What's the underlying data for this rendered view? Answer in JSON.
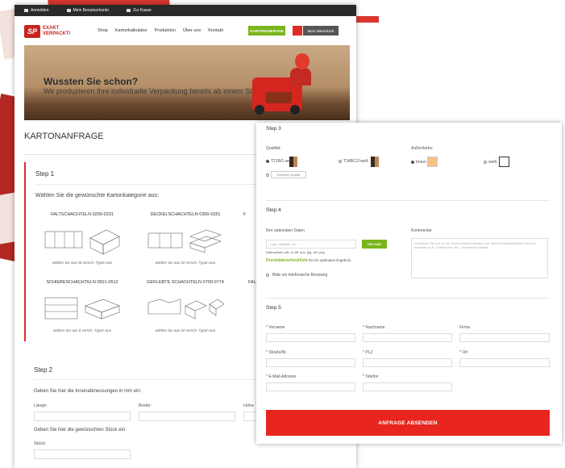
{
  "topbar": {
    "items": [
      {
        "label": "Anmelden",
        "icon": "login-icon"
      },
      {
        "label": "Mein Benutzerkonto",
        "icon": "user-icon"
      },
      {
        "label": "Zur Kasse",
        "icon": "cart-icon"
      }
    ]
  },
  "header": {
    "logo_line1": "EXAKT",
    "logo_line2": "VERPACKT!",
    "logo_mark": "SP",
    "nav": [
      "Shop",
      "Kartonkalkulator",
      "Produktion",
      "Über uns",
      "Kontakt"
    ],
    "cta_label": "KARTONANFRAGE",
    "cart_label": "Mein Warenkorb",
    "colors": {
      "accent": "#e22a26",
      "green": "#7ab51d",
      "dark": "#2a2a2a"
    }
  },
  "banner": {
    "title": "Wussten Sie schon?",
    "subtitle": "Wir produzieren Ihre individuelle Verpackung bereits ab einem Stück"
  },
  "page_title": "KARTONANFRAGE",
  "step1": {
    "label": "Step 1",
    "instruction": "Wählen Sie die gewünschte Kartonkategorie aus:",
    "categories": [
      {
        "name": "FALTSCHACHTELN 0200-0231",
        "note": "wählen Sie aus 25 versch. Typen aus"
      },
      {
        "name": "DECKELSCHACHTELN 0300-0351",
        "note": "wählen Sie aus 32 versch. Typen aus"
      },
      {
        "name": "F",
        "note": ""
      },
      {
        "name": "SCHIEBESCHACHTELN 0501-0512",
        "note": "wählen Sie aus 8 versch. Typen aus"
      },
      {
        "name": "GEKLEBTE SCHACHTELN 0700-0774",
        "note": "wählen Sie aus 32 versch. Typen aus"
      },
      {
        "name": "FAL",
        "note": ""
      }
    ]
  },
  "step2": {
    "label": "Step 2",
    "instruction_dims": "Geben Sie hier die Innenabmessungen in mm ein:",
    "length_label": "Länge:",
    "width_label": "Breite:",
    "height_label": "Höhe",
    "instruction_qty": "Geben Sie hier die gewünschten Stück ein:",
    "qty_label": "Stück:"
  },
  "step3": {
    "label": "Step 3",
    "quality_label": "Qualität:",
    "quality_options": [
      "T21B/1-welt.",
      "T34BC/2-welt."
    ],
    "quality_selected": "T21B/1-welt.",
    "quality_more": "Erweiterte Qualität",
    "color_label": "Außenfarbe:",
    "color_options": [
      "braun",
      "weiß"
    ],
    "color_selected": "braun"
  },
  "step4": {
    "label": "Step 4",
    "upload_label": "Ihre optionalen Daten",
    "upload_placeholder": "Logo, Beispiel, etc.",
    "upload_button": "UPLOAD",
    "upload_formats": "Dateupload: pdf, ai, tiff, eps, jpg, dxf, png",
    "checklist_link": "Druckdatencheckliste",
    "checklist_text": "für ein optimales Ergebnis",
    "phone_consult": "Bitte um telefonische Beratung",
    "comment_label": "Kommentar",
    "comment_placeholder": "Schreiben Sie uns wo Ihr Druck platziert werden soll. Welche Besonderheiten sind zu beachten (z.B. Griffloecher etc.). Technische Details."
  },
  "step5": {
    "label": "Step 5",
    "fields": [
      {
        "label": "Vorname",
        "required": true
      },
      {
        "label": "Nachname",
        "required": true
      },
      {
        "label": "Firma",
        "required": false
      },
      {
        "label": "Straße/Nr.",
        "required": true
      },
      {
        "label": "PLZ",
        "required": true
      },
      {
        "label": "Ort",
        "required": true
      },
      {
        "label": "E-Mail-Adresse",
        "required": true
      },
      {
        "label": "Telefon",
        "required": true
      }
    ],
    "submit_label": "ANFRAGE ABSENDEN",
    "required_mark": "*"
  }
}
